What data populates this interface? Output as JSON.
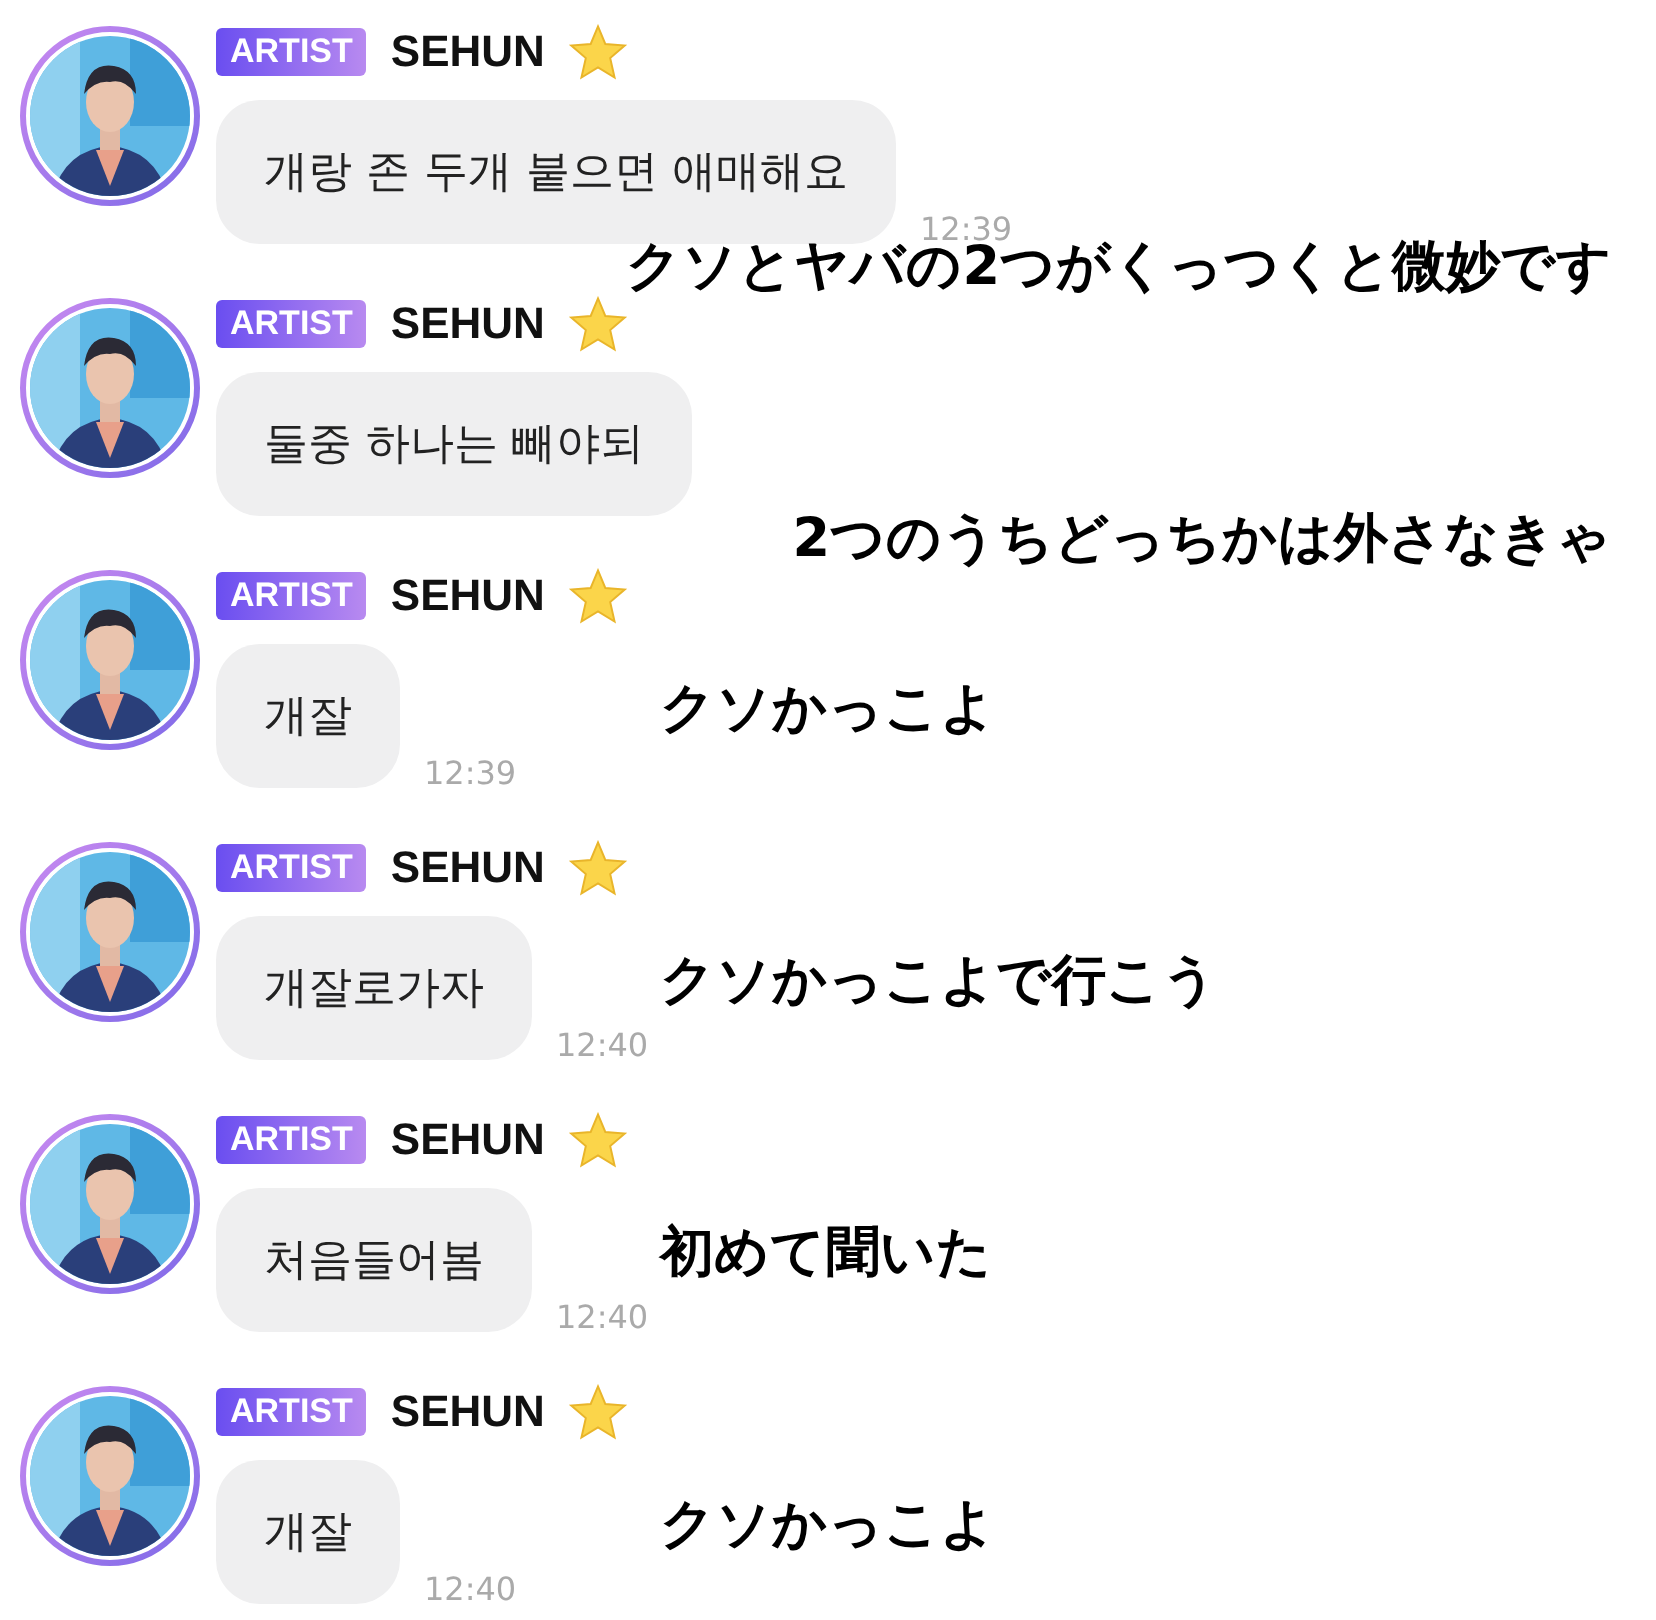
{
  "messages": [
    {
      "badge": "ARTIST",
      "name": "SEHUN",
      "text": "개랑 존 두개 붙으면 애매해요",
      "time": "12:39",
      "caption": "クソとヤバの2つがくっつくと微妙です",
      "kind": "below"
    },
    {
      "badge": "ARTIST",
      "name": "SEHUN",
      "text": "둘중 하나는 빼야되",
      "caption": "2つのうちどっちかは外さなきゃ",
      "kind": "below"
    },
    {
      "badge": "ARTIST",
      "name": "SEHUN",
      "text": "개잘",
      "time": "12:39",
      "caption": "クソかっこよ",
      "kind": "beside"
    },
    {
      "badge": "ARTIST",
      "name": "SEHUN",
      "text": "개잘로가자",
      "time": "12:40",
      "caption": "クソかっこよで行こう",
      "kind": "beside"
    },
    {
      "badge": "ARTIST",
      "name": "SEHUN",
      "text": "처음들어봄",
      "time": "12:40",
      "caption": "初めて聞いた",
      "kind": "beside"
    },
    {
      "badge": "ARTIST",
      "name": "SEHUN",
      "text": "개잘",
      "time": "12:40",
      "caption": "クソかっこよ",
      "kind": "beside"
    }
  ]
}
